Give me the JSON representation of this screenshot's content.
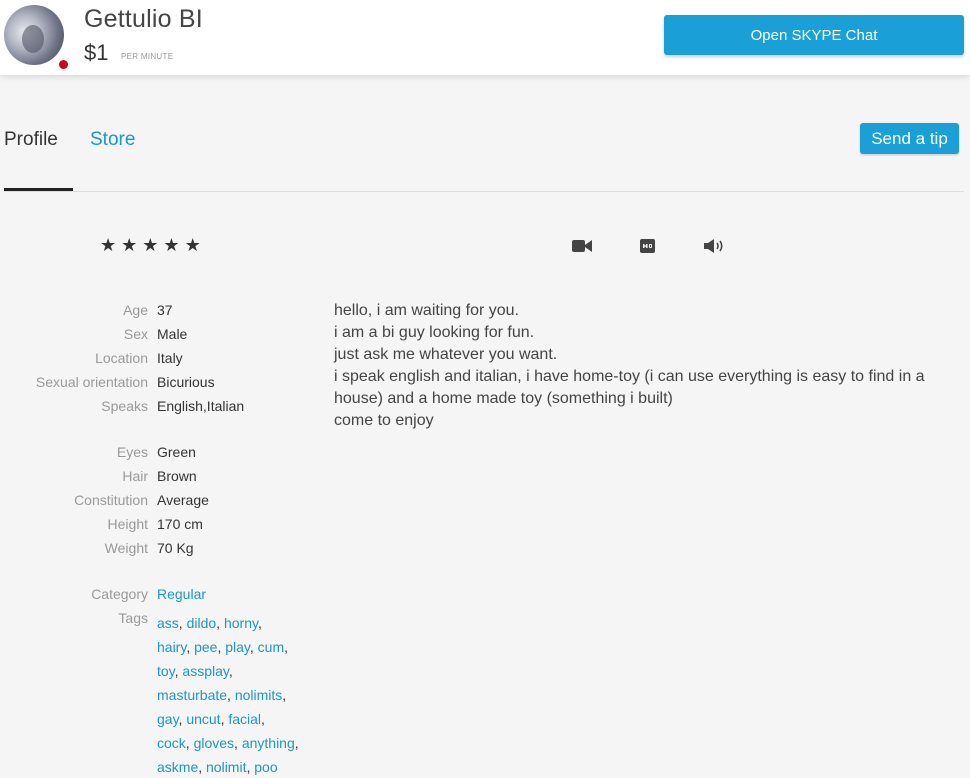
{
  "header": {
    "name": "Gettulio BI",
    "price": "$1",
    "price_unit": "PER MINUTE",
    "skype_button": "Open SKYPE Chat",
    "status_color": "#d0021b"
  },
  "tabs": [
    {
      "label": "Profile",
      "active": true
    },
    {
      "label": "Store",
      "active": false
    }
  ],
  "tip_button": "Send a tip",
  "rating": {
    "stars": 5,
    "glyph": "★"
  },
  "media_icons": [
    "video-camera-icon",
    "hd-icon",
    "speaker-icon"
  ],
  "details": [
    {
      "label": "Age",
      "value": "37"
    },
    {
      "label": "Sex",
      "value": "Male"
    },
    {
      "label": "Location",
      "value": "Italy"
    },
    {
      "label": "Sexual orientation",
      "value": "Bicurious"
    },
    {
      "label": "Speaks",
      "value": "English,Italian"
    },
    {
      "label": "Eyes",
      "value": "Green"
    },
    {
      "label": "Hair",
      "value": "Brown"
    },
    {
      "label": "Constitution",
      "value": "Average"
    },
    {
      "label": "Height",
      "value": "170 cm"
    },
    {
      "label": "Weight",
      "value": "70 Kg"
    },
    {
      "label": "Category",
      "value": "Regular"
    }
  ],
  "tags_label": "Tags",
  "tags": [
    "ass",
    "dildo",
    "horny",
    "hairy",
    "pee",
    "play",
    "cum",
    "toy",
    "assplay",
    "masturbate",
    "nolimits",
    "gay",
    "uncut",
    "facial",
    "cock",
    "gloves",
    "anything",
    "askme",
    "nolimit",
    "poo"
  ],
  "bio": [
    "hello, i am waiting for you.",
    "i am a bi guy looking for fun.",
    "just ask me whatever you want.",
    "i speak english and italian, i have home-toy (i can use everything is easy to find in a house) and a home made toy (something i built)",
    "come to enjoy"
  ],
  "colors": {
    "accent": "#1aa0d6",
    "link": "#1a97c7",
    "background": "#f5f5f5"
  }
}
